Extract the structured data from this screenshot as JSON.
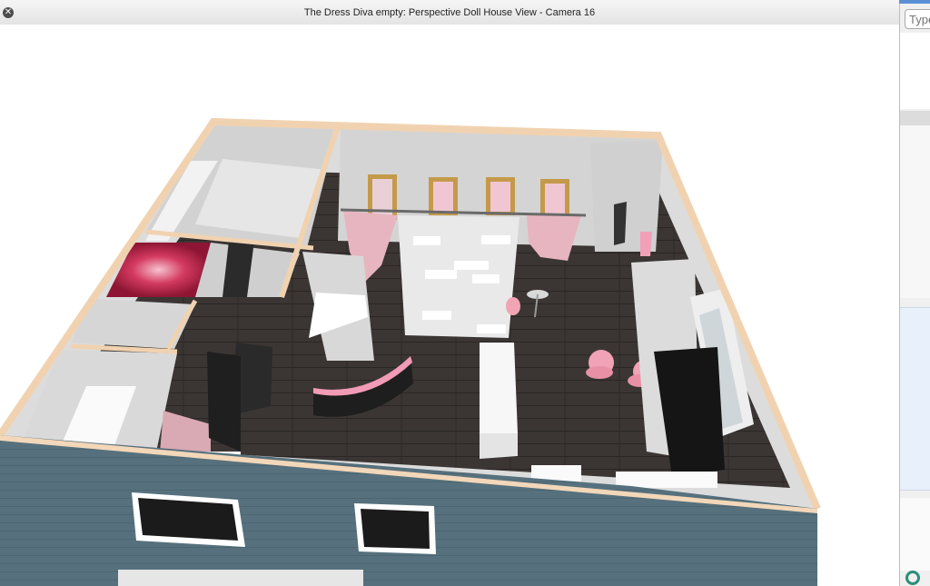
{
  "window": {
    "title": "The Dress Diva empty: Perspective Doll House View - Camera 16",
    "close_glyph": "✕"
  },
  "side_panel": {
    "search_placeholder": "Type"
  },
  "icons": {
    "close": "close-icon",
    "help": "help-icon"
  },
  "colors": {
    "exterior_wall": "#56717d",
    "floor": "#3a3533",
    "wall_top": "#f1d2b0",
    "accent_pink": "#f0a2b6"
  }
}
